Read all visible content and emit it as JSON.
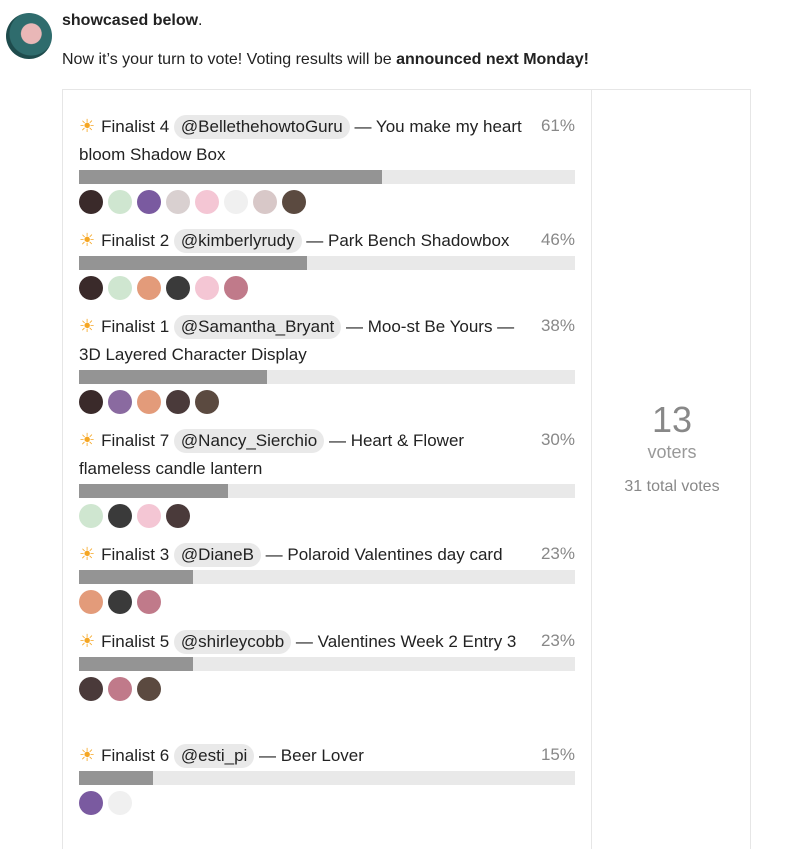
{
  "intro": {
    "bold_tail": "showcased below",
    "punct": ".",
    "line2_start": "Now it’s your turn to vote! Voting results will be ",
    "line2_bold": "announced next Monday!"
  },
  "poll": {
    "options": [
      {
        "label": "Finalist 4",
        "mention": "@BellethehowtoGuru",
        "title": "— You make my heart bloom Shadow Box",
        "pct": "61%",
        "value": 0.61,
        "voters": [
          "#3a2a2a",
          "#cfe6d0",
          "#7a5aa0",
          "#d9d0d0",
          "#f4c6d4",
          "#f0f0f0",
          "#d8c8c8",
          "#5b4a40"
        ]
      },
      {
        "label": "Finalist 2",
        "mention": "@kimberlyrudy",
        "title": "— Park Bench Shadowbox",
        "pct": "46%",
        "value": 0.46,
        "voters": [
          "#3a2a2a",
          "#cfe6d0",
          "#e39b7a",
          "#3a3a3a",
          "#f4c6d4",
          "#c07a8a"
        ]
      },
      {
        "label": "Finalist 1",
        "mention": "@Samantha_Bryant",
        "title": "— Moo-st Be Yours — 3D Layered Character Display",
        "pct": "38%",
        "value": 0.38,
        "voters": [
          "#3a2a2a",
          "#8a6aa0",
          "#e39b7a",
          "#4a3a3a",
          "#5b4a40"
        ]
      },
      {
        "label": "Finalist 7",
        "mention": "@Nancy_Sierchio",
        "title": "— Heart & Flower flameless candle lantern",
        "pct": "30%",
        "value": 0.3,
        "voters": [
          "#cfe6d0",
          "#3a3a3a",
          "#f4c6d4",
          "#4a3a3a"
        ]
      },
      {
        "label": "Finalist 3",
        "mention": "@DianeB",
        "title": "— Polaroid Valentines day card",
        "pct": "23%",
        "value": 0.23,
        "voters": [
          "#e39b7a",
          "#3a3a3a",
          "#c07a8a"
        ]
      },
      {
        "label": "Finalist 5",
        "mention": "@shirleycobb",
        "title": "— Valentines Week 2 Entry 3",
        "pct": "23%",
        "value": 0.23,
        "voters": [
          "#4a3a3a",
          "#c07a8a",
          "#5b4a40"
        ]
      },
      {
        "label": "Finalist 6",
        "mention": "@esti_pi",
        "title": "— Beer Lover",
        "pct": "15%",
        "value": 0.15,
        "voters": [
          "#7a5aa0",
          "#f0f0f0"
        ]
      }
    ],
    "voter_count": "13",
    "voter_label": "voters",
    "total_votes": "31 total votes"
  },
  "colors": {
    "bar_fill": "#949494",
    "bar_track": "#e9e9e9",
    "mention_bg": "#e9e9e9",
    "sun": "#f5a623"
  }
}
